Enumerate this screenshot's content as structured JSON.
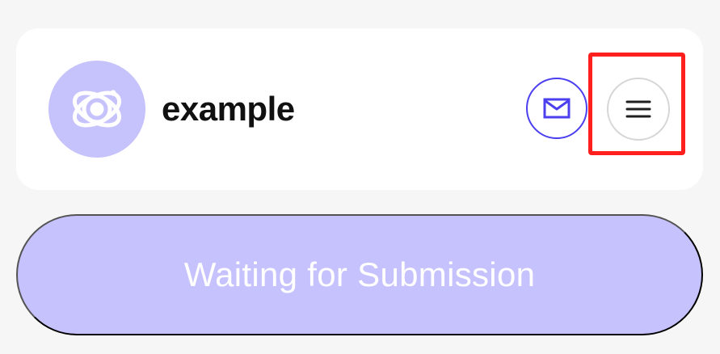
{
  "profile": {
    "name": "example",
    "avatar_icon": "atom-planet-icon",
    "avatar_color": "#c6c2fb"
  },
  "actions": {
    "mail_icon": "mail-icon",
    "menu_icon": "hamburger-menu-icon",
    "accent_color": "#4b3ff0",
    "highlight_color": "#ff1f1f"
  },
  "status": {
    "label": "Waiting for Submission",
    "background_color": "#c6c2fd"
  }
}
